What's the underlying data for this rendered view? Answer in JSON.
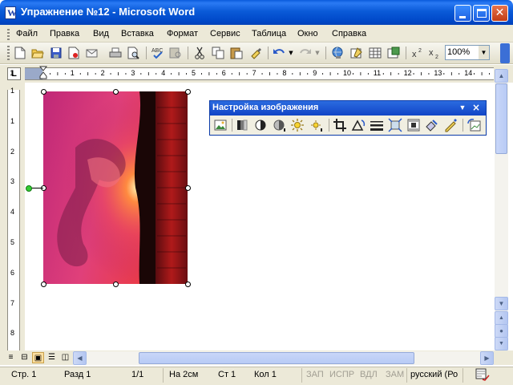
{
  "window": {
    "title": "Упражнение №12 - Microsoft Word",
    "app_icon": "word-icon",
    "controls": [
      "minimize-icon",
      "maximize-icon",
      "close-icon"
    ]
  },
  "menu": [
    {
      "label": "Файл"
    },
    {
      "label": "Правка"
    },
    {
      "label": "Вид"
    },
    {
      "label": "Вставка"
    },
    {
      "label": "Формат"
    },
    {
      "label": "Сервис"
    },
    {
      "label": "Таблица"
    },
    {
      "label": "Окно"
    },
    {
      "label": "Справка"
    }
  ],
  "toolbar": {
    "zoom": "100%",
    "icons": [
      "new-document-icon",
      "open-icon",
      "save-icon",
      "permission-icon",
      "email-icon",
      "print-icon",
      "print-preview-icon",
      "spelling-icon",
      "research-icon",
      "cut-icon",
      "copy-icon",
      "paste-icon",
      "format-painter-icon",
      "undo-icon",
      "redo-icon",
      "hyperlink-icon",
      "tables-borders-icon",
      "insert-table-icon",
      "insert-excel-icon",
      "superscript-icon",
      "subscript-icon"
    ]
  },
  "ruler": {
    "tab_selector": "L",
    "h_numbers": [
      "1",
      "1",
      "2",
      "3",
      "4",
      "5",
      "6",
      "7",
      "8",
      "9",
      "10",
      "11",
      "12",
      "13",
      "14"
    ],
    "v_numbers": [
      "1",
      "1",
      "2",
      "3",
      "4",
      "5",
      "6",
      "7",
      "8"
    ]
  },
  "picture_toolbar": {
    "title": "Настройка изображения",
    "icons": [
      "insert-picture-icon",
      "color-icon",
      "more-contrast-icon",
      "less-contrast-icon",
      "more-brightness-icon",
      "less-brightness-icon",
      "crop-icon",
      "rotate-left-icon",
      "line-style-icon",
      "compress-pictures-icon",
      "text-wrapping-icon",
      "format-picture-icon",
      "set-transparent-color-icon",
      "reset-picture-icon"
    ]
  },
  "picture": {
    "description_icon": "sunset-image"
  },
  "status": {
    "page": "Стр. 1",
    "section": "Разд 1",
    "page_count": "1/1",
    "at": "На 2см",
    "line": "Ст 1",
    "column": "Кол 1",
    "rec": "ЗАП",
    "trk": "ИСПР",
    "ext": "ВДЛ",
    "ovr": "ЗАМ",
    "language": "русский (Ро"
  }
}
